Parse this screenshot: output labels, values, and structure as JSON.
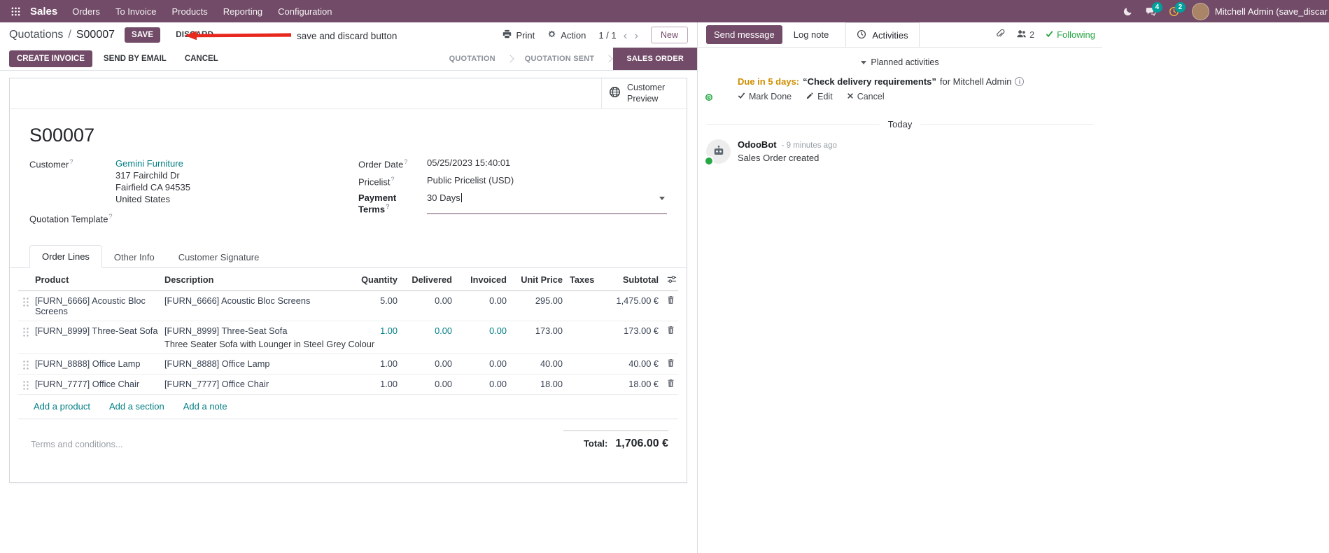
{
  "colors": {
    "brand": "#714B67",
    "link_teal": "#017E84",
    "annotation_red": "#E8271F",
    "success_green": "#28A745",
    "activity_due_orange": "#CE8D00",
    "badge_teal": "#00A09D"
  },
  "icons": {
    "apps_grid": "3x3 dot grid",
    "moon": "dark-mode crescent",
    "chat": "speech bubbles",
    "clock": "clock face",
    "printer": "printer",
    "gear": "gear",
    "globe": "globe",
    "drag_handle": "dot grid handle",
    "trash": "trash can",
    "sliders": "optional columns toggle",
    "paperclip": "attachment",
    "people": "followers",
    "check": "checkmark",
    "pencil": "edit pencil",
    "x": "cancel cross",
    "robot": "odoobot"
  },
  "help_marker": "?",
  "topbar": {
    "app_name": "Sales",
    "menus": [
      "Orders",
      "To Invoice",
      "Products",
      "Reporting",
      "Configuration"
    ],
    "messages_badge": "4",
    "activities_badge": "2",
    "user_name": "Mitchell Admin (save_discar"
  },
  "control_panel": {
    "breadcrumb_parent": "Quotations",
    "breadcrumb_sep": "/",
    "breadcrumb_current": "S00007",
    "save": "SAVE",
    "discard": "DISCARD",
    "print": "Print",
    "action": "Action",
    "pager": "1 / 1",
    "prev": "‹",
    "next": "›",
    "new": "New"
  },
  "annotation": {
    "text": "save and discard button"
  },
  "statusbar": {
    "create_invoice": "CREATE INVOICE",
    "send_by_email": "SEND BY EMAIL",
    "cancel": "CANCEL",
    "stages": [
      "QUOTATION",
      "QUOTATION SENT",
      "SALES ORDER"
    ],
    "active_stage": "SALES ORDER"
  },
  "sheet": {
    "customer_preview": "Customer Preview",
    "title": "S00007",
    "customer_label": "Customer",
    "customer_name": "Gemini Furniture",
    "address_line1": "317 Fairchild Dr",
    "address_line2": "Fairfield CA 94535",
    "address_line3": "United States",
    "quotation_template_label": "Quotation Template",
    "order_date_label": "Order Date",
    "order_date_value": "05/25/2023 15:40:01",
    "pricelist_label": "Pricelist",
    "pricelist_value": "Public Pricelist (USD)",
    "payment_terms_label": "Payment Terms",
    "payment_terms_value": "30 Days",
    "tabs": [
      "Order Lines",
      "Other Info",
      "Customer Signature"
    ]
  },
  "order_table": {
    "headers": {
      "product": "Product",
      "description": "Description",
      "quantity": "Quantity",
      "delivered": "Delivered",
      "invoiced": "Invoiced",
      "unit_price": "Unit Price",
      "taxes": "Taxes",
      "subtotal": "Subtotal"
    },
    "rows": [
      {
        "product": "[FURN_6666] Acoustic Bloc Screens",
        "description": "[FURN_6666] Acoustic Bloc Screens",
        "quantity": "5.00",
        "delivered": "0.00",
        "invoiced": "0.00",
        "unit_price": "295.00",
        "taxes": "",
        "subtotal": "1,475.00 €"
      },
      {
        "product": "[FURN_8999] Three-Seat Sofa",
        "description": "[FURN_8999] Three-Seat Sofa",
        "description_sub": "Three Seater Sofa with Lounger in Steel Grey Colour",
        "quantity": "1.00",
        "delivered": "0.00",
        "invoiced": "0.00",
        "unit_price": "173.00",
        "taxes": "",
        "subtotal": "173.00 €"
      },
      {
        "product": "[FURN_8888] Office Lamp",
        "description": "[FURN_8888] Office Lamp",
        "quantity": "1.00",
        "delivered": "0.00",
        "invoiced": "0.00",
        "unit_price": "40.00",
        "taxes": "",
        "subtotal": "40.00 €"
      },
      {
        "product": "[FURN_7777] Office Chair",
        "description": "[FURN_7777] Office Chair",
        "quantity": "1.00",
        "delivered": "0.00",
        "invoiced": "0.00",
        "unit_price": "18.00",
        "taxes": "",
        "subtotal": "18.00 €"
      }
    ],
    "add_product": "Add a product",
    "add_section": "Add a section",
    "add_note": "Add a note"
  },
  "footer": {
    "terms_placeholder": "Terms and conditions...",
    "total_label": "Total:",
    "total_value": "1,706.00 €"
  },
  "chatter": {
    "send_message": "Send message",
    "log_note": "Log note",
    "activities_tab": "Activities",
    "followers_count": "2",
    "following": "Following",
    "planned_activities": "Planned activities",
    "activity_due": "Due in 5 days:",
    "activity_summary": "“Check delivery requirements”",
    "activity_for": "for Mitchell Admin",
    "info_glyph": "i",
    "mark_done": "Mark Done",
    "edit": "Edit",
    "cancel": "Cancel",
    "today": "Today",
    "message_author": "OdooBot",
    "message_time": "- 9 minutes ago",
    "message_body": "Sales Order created"
  }
}
